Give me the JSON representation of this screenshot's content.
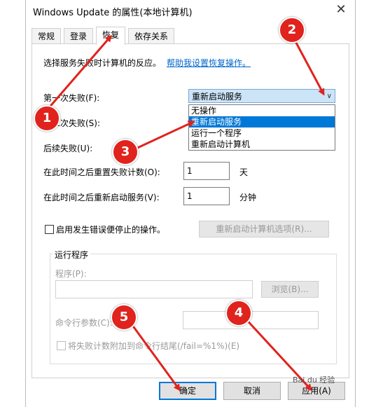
{
  "window": {
    "title": "Windows Update 的属性(本地计算机)",
    "close_glyph": "✕"
  },
  "tabs": [
    {
      "label": "常规",
      "active": false
    },
    {
      "label": "登录",
      "active": false
    },
    {
      "label": "恢复",
      "active": true
    },
    {
      "label": "依存关系",
      "active": false
    }
  ],
  "recovery": {
    "intro_text": "选择服务失败时计算机的反应。",
    "help_link": "帮助我设置恢复操作。",
    "first_failure_label": "第一次失败(F):",
    "first_failure_value": "重新启动服务",
    "second_failure_label": "第二次失败(S):",
    "subsequent_failure_label": "后续失败(U):",
    "dropdown_options": [
      {
        "label": "无操作",
        "selected": false
      },
      {
        "label": "重新启动服务",
        "selected": true
      },
      {
        "label": "运行一个程序",
        "selected": false
      },
      {
        "label": "重新启动计算机",
        "selected": false
      }
    ],
    "reset_label": "在此时间之后重置失败计数(O):",
    "reset_value": "1",
    "reset_unit": "天",
    "restart_label": "在此时间之后重新启动服务(V):",
    "restart_value": "1",
    "restart_unit": "分钟",
    "stop_error_checkbox_label": "启用发生错误便停止的操作。",
    "restart_computer_options_button": "重新启动计算机选项(R)...",
    "run_program_group_title": "运行程序",
    "program_label": "程序(P):",
    "browse_button": "浏览(B)...",
    "cmd_params_label": "命令行参数(C):",
    "append_fail_checkbox_label": "将失败计数附加到命令行结尾(/fail=%1%)(E)"
  },
  "footer": {
    "ok": "确定",
    "cancel": "取消",
    "apply": "应用(A)"
  },
  "annotations": {
    "markers": [
      "1",
      "2",
      "3",
      "4",
      "5"
    ],
    "color": "#e0231d"
  },
  "watermark": {
    "text": "Bai du 经验"
  }
}
